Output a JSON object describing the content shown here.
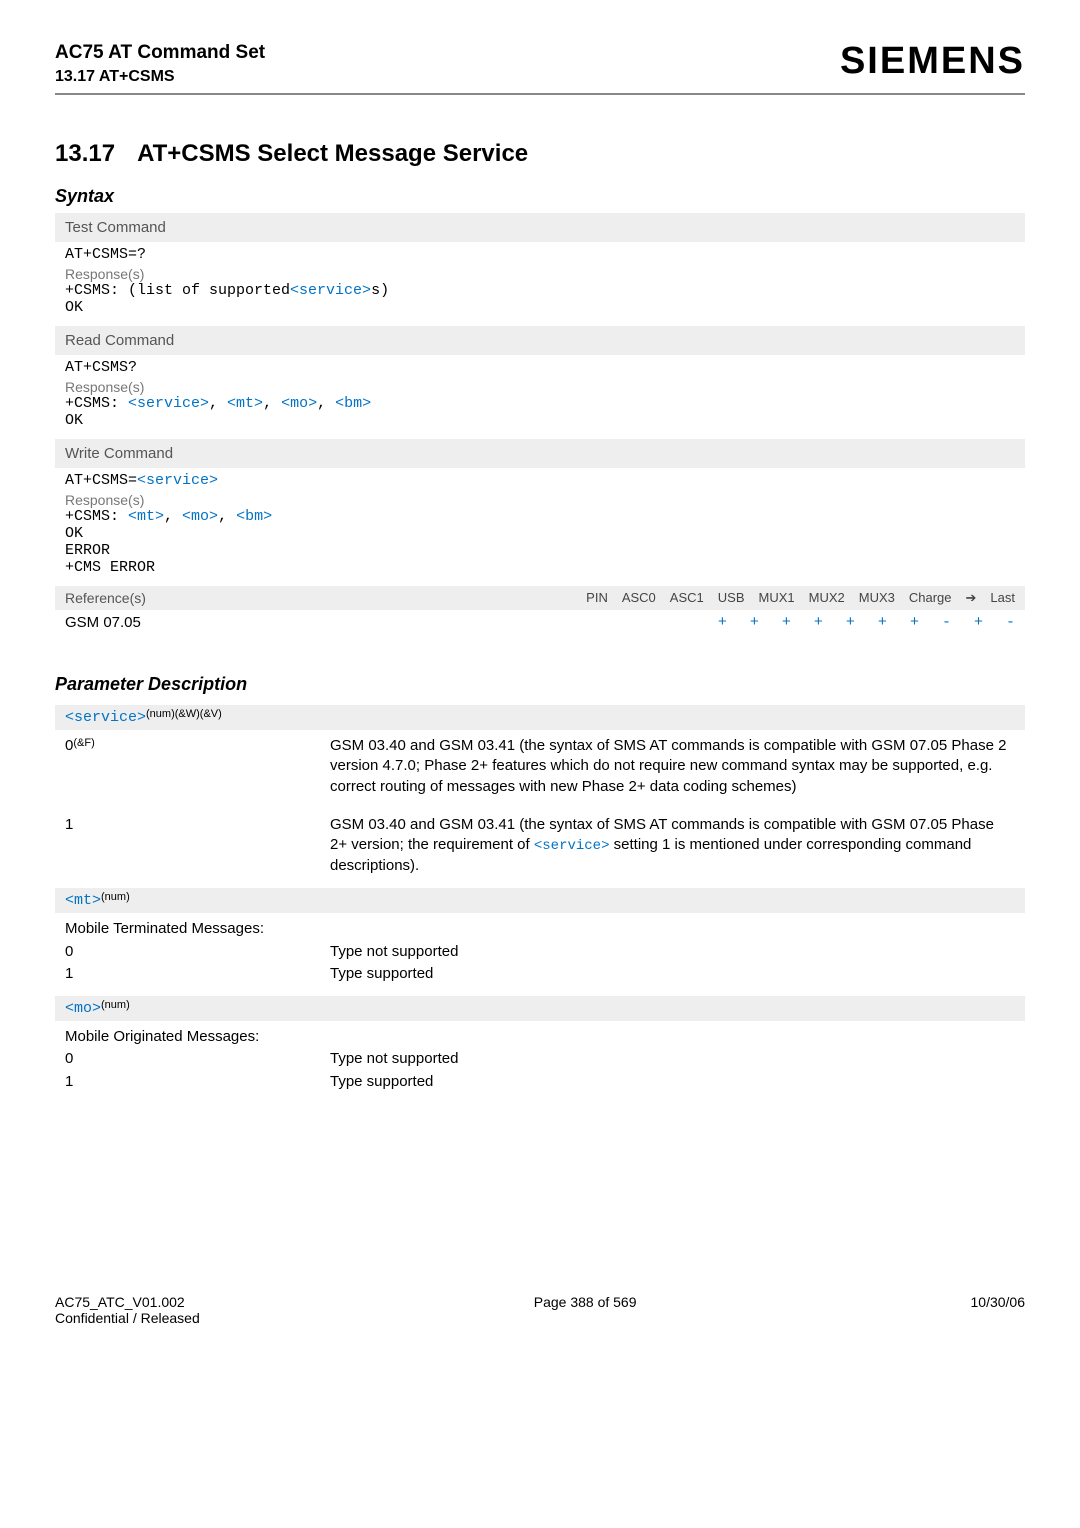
{
  "header": {
    "doc_title": "AC75 AT Command Set",
    "doc_subtitle": "13.17 AT+CSMS",
    "brand": "SIEMENS"
  },
  "section": {
    "num": "13.17",
    "title": "AT+CSMS   Select Message Service"
  },
  "syntax_label": "Syntax",
  "blocks": {
    "test": {
      "label": "Test Command",
      "cmd": "AT+CSMS=?",
      "resp_label": "Response(s)",
      "line_pre": "+CSMS: (list of supported",
      "token": "<service>",
      "line_post": "s)",
      "ok": "OK"
    },
    "read": {
      "label": "Read Command",
      "cmd": "AT+CSMS?",
      "resp_label": "Response(s)",
      "pre": "+CSMS: ",
      "t1": "<service>",
      "c1": ", ",
      "t2": "<mt>",
      "c2": ", ",
      "t3": "<mo>",
      "c3": ", ",
      "t4": "<bm>",
      "ok": "OK"
    },
    "write": {
      "label": "Write Command",
      "cmd_pre": "AT+CSMS=",
      "cmd_tok": "<service>",
      "resp_label": "Response(s)",
      "pre": "+CSMS: ",
      "t1": "<mt>",
      "c1": ", ",
      "t2": "<mo>",
      "c2": ", ",
      "t3": "<bm>",
      "ok": "OK",
      "err": "ERROR",
      "cms": "+CMS ERROR"
    }
  },
  "reference": {
    "label": "Reference(s)",
    "cols": [
      "PIN",
      "ASC0",
      "ASC1",
      "USB",
      "MUX1",
      "MUX2",
      "MUX3",
      "Charge",
      "➔",
      "Last"
    ],
    "name": "GSM 07.05",
    "vals": [
      "+",
      "+",
      "+",
      "+",
      "+",
      "+",
      "+",
      "-",
      "+",
      "-"
    ]
  },
  "param_title": "Parameter Description",
  "params": {
    "service": {
      "header_tok": "<service>",
      "header_sup": "(num)(&W)(&V)",
      "rows": [
        {
          "key": "0",
          "key_sup": "(&F)",
          "text": "GSM 03.40 and GSM 03.41 (the syntax of SMS AT commands is compatible with GSM 07.05 Phase 2 version 4.7.0; Phase 2+ features which do not require new command syntax may be supported, e.g. correct routing of messages with new Phase 2+ data coding schemes)"
        },
        {
          "key": "1",
          "text_pre": "GSM 03.40 and GSM 03.41 (the syntax of SMS AT commands is compatible with GSM 07.05 Phase 2+ version; the requirement of ",
          "tok": "<service>",
          "text_post": " setting 1 is mentioned under corresponding command descriptions)."
        }
      ]
    },
    "mt": {
      "header_tok": "<mt>",
      "header_sup": "(num)",
      "intro": "Mobile Terminated Messages:",
      "rows": [
        {
          "key": "0",
          "text": "Type not supported"
        },
        {
          "key": "1",
          "text": "Type supported"
        }
      ]
    },
    "mo": {
      "header_tok": "<mo>",
      "header_sup": "(num)",
      "intro": "Mobile Originated Messages:",
      "rows": [
        {
          "key": "0",
          "text": "Type not supported"
        },
        {
          "key": "1",
          "text": "Type supported"
        }
      ]
    }
  },
  "footer": {
    "left1": "AC75_ATC_V01.002",
    "left2": "Confidential / Released",
    "center": "Page 388 of 569",
    "right": "10/30/06"
  }
}
